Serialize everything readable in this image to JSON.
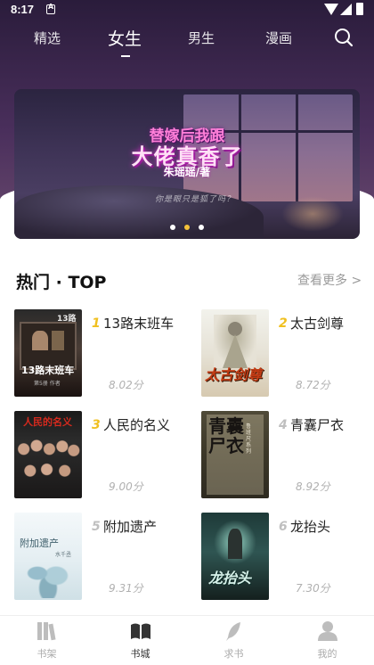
{
  "status_bar": {
    "time": "8:17"
  },
  "top_nav": {
    "tabs": [
      {
        "label": "精选"
      },
      {
        "label": "女生"
      },
      {
        "label": "男生"
      },
      {
        "label": "漫画"
      }
    ],
    "active_tab": "女生"
  },
  "banner": {
    "title_line1": "替嫁后我跟",
    "title_line2": "大佬真香了",
    "author": "朱瑶瑶/著",
    "quote": "你是眼只是狐了吗？",
    "slide_count": 3,
    "active_slide": 2
  },
  "hot_section": {
    "title": "热门 · TOP",
    "more_label": "查看更多 >",
    "books": [
      {
        "rank": "1",
        "name": "13路末班车",
        "score": "8.02分",
        "rank_color": "#f0c020",
        "cover_text_main": "13路末班车",
        "cover_text_top": "13路",
        "cover_text_sub": "第5册 作者"
      },
      {
        "rank": "2",
        "name": "太古剑尊",
        "score": "8.72分",
        "rank_color": "#f0c020",
        "cover_text_main": "太古剑尊"
      },
      {
        "rank": "3",
        "name": "人民的名义",
        "score": "9.00分",
        "rank_color": "#f0c020",
        "cover_text_main": "人民的名义"
      },
      {
        "rank": "4",
        "name": "青囊尸衣",
        "score": "8.92分",
        "rank_color": "#bfbfbf",
        "cover_text_main": "青囊尸衣",
        "cover_text_sub": "鲁班尺系列"
      },
      {
        "rank": "5",
        "name": "附加遗产",
        "score": "9.31分",
        "rank_color": "#bfbfbf",
        "cover_text_main": "附加遗产",
        "cover_text_sub": "水千丞"
      },
      {
        "rank": "6",
        "name": "龙抬头",
        "score": "7.30分",
        "rank_color": "#bfbfbf",
        "cover_text_main": "龙抬头"
      }
    ]
  },
  "bottom_nav": {
    "items": [
      {
        "label": "书架"
      },
      {
        "label": "书城"
      },
      {
        "label": "求书"
      },
      {
        "label": "我的"
      }
    ],
    "active": "书城"
  }
}
